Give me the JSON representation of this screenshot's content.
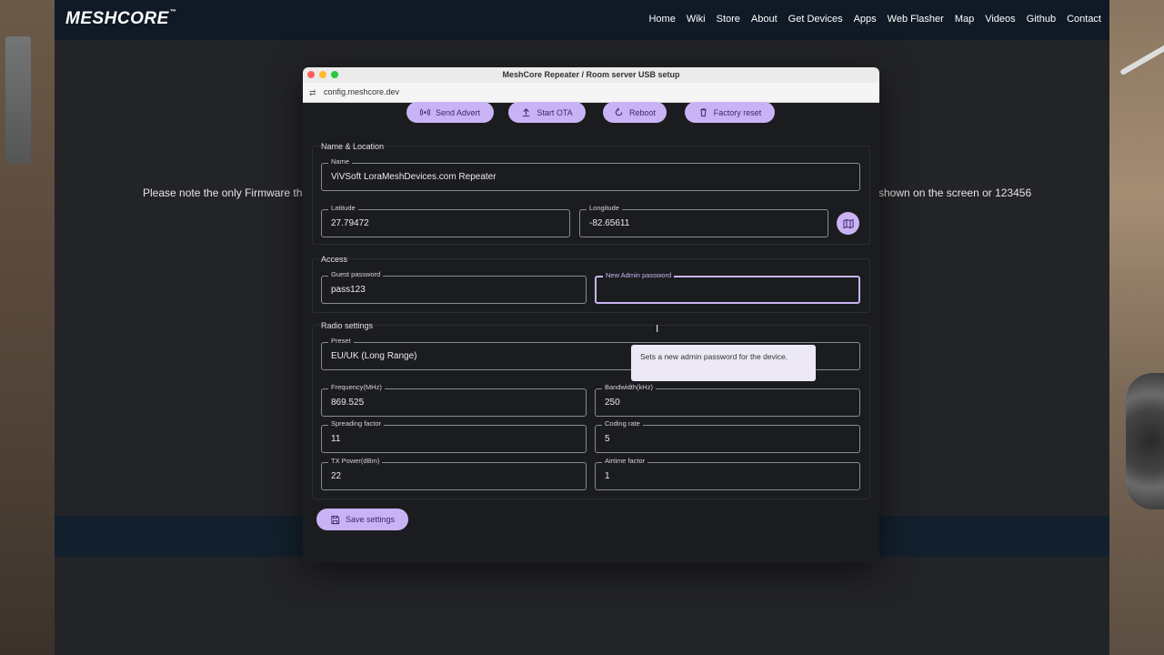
{
  "brand": {
    "logo": "MESHCORE",
    "tm": "™"
  },
  "nav": [
    "Home",
    "Wiki",
    "Store",
    "About",
    "Get Devices",
    "Apps",
    "Web Flasher",
    "Map",
    "Videos",
    "Github",
    "Contact"
  ],
  "background_note": {
    "left": "Please note the only Firmware that",
    "right": "shown on the screen or 123456"
  },
  "window": {
    "title": "MeshCore Repeater / Room server USB setup",
    "url": "config.meshcore.dev"
  },
  "actions": {
    "send_advert": "Send Advert",
    "start_ota": "Start OTA",
    "reboot": "Reboot",
    "factory_reset": "Factory reset"
  },
  "name_location": {
    "title": "Name & Location",
    "name_label": "Name",
    "name_value": "ViVSoft LoraMeshDevices.com Repeater",
    "lat_label": "Latitude",
    "lat_value": "27.79472",
    "lon_label": "Longitude",
    "lon_value": "-82.65611"
  },
  "access": {
    "title": "Access",
    "guest_label": "Guest password",
    "guest_value": "pass123",
    "admin_label": "New Admin password",
    "admin_value": "",
    "tooltip": "Sets a new admin password for the device."
  },
  "radio": {
    "title": "Radio settings",
    "preset_label": "Preset",
    "preset_value": "EU/UK (Long Range)",
    "freq_label": "Frequency(MHz)",
    "freq_value": "869.525",
    "bw_label": "Bandwidth(kHz)",
    "bw_value": "250",
    "sf_label": "Spreading factor",
    "sf_value": "11",
    "cr_label": "Coding rate",
    "cr_value": "5",
    "tx_label": "TX Power(dBm)",
    "tx_value": "22",
    "af_label": "Airtime factor",
    "af_value": "1"
  },
  "save_label": "Save settings",
  "colors": {
    "accent": "#c9b3f5",
    "nav_bg": "#0f1a26",
    "dialog_bg": "#1b1c1f"
  }
}
